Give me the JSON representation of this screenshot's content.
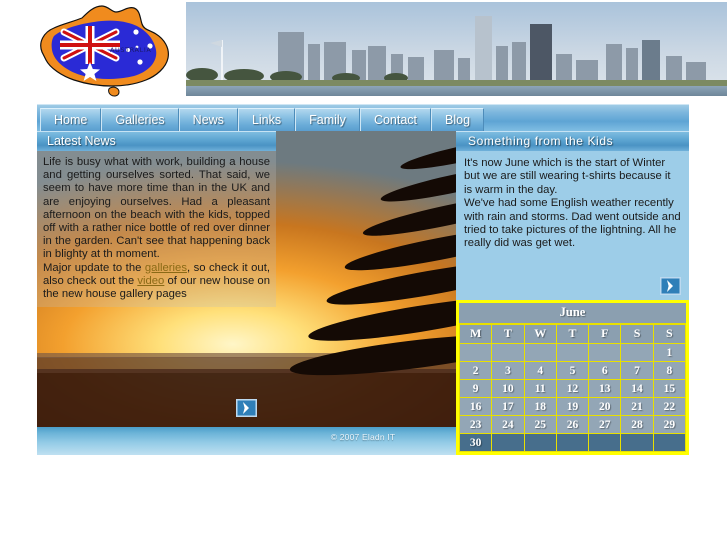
{
  "site": {
    "logo_alt": "australia-flag-map-logo",
    "logo_label": "AUSTRALIA",
    "banner_alt": "perth-city-skyline-banner"
  },
  "nav": {
    "items": [
      {
        "label": "Home"
      },
      {
        "label": "Galleries"
      },
      {
        "label": "News"
      },
      {
        "label": "Links"
      },
      {
        "label": "Family"
      },
      {
        "label": "Contact"
      },
      {
        "label": "Blog"
      }
    ]
  },
  "news_panel": {
    "title": "Latest News",
    "paragraph1": "Life is busy what with work, building a house and getting ourselves sorted.  That said, we seem to have more time than in the UK and are enjoying ourselves.   Had  a pleasant afternoon on the beach with the kids, topped off with a rather nice bottle of red over dinner in the garden.   Can't see that happening back in blighty at th moment.",
    "para2_pre": "Major  update  to  the  ",
    "link_galleries": "galleries",
    "para2_mid": ",  so  check  it out,  also  check  out  the  ",
    "link_video": "video",
    "para2_post": "  of  our  new house on the new house gallery pages",
    "more_arrow": "next-arrow-icon"
  },
  "kids_panel": {
    "title": "Something from the Kids",
    "paragraph1": "It's now June which is the start of Winter but we are still wearing t-shirts because it is warm in the day.",
    "paragraph2": "We've had some English weather recently with rain and storms.  Dad went outside and tried to take pictures of the lightning.  All he really did was get wet.",
    "more_arrow": "next-arrow-icon"
  },
  "calendar": {
    "month": "June",
    "weekday_headers": [
      "M",
      "T",
      "W",
      "T",
      "F",
      "S",
      "S"
    ],
    "weeks": [
      [
        "",
        "",
        "",
        "",
        "",
        "",
        "1"
      ],
      [
        "2",
        "3",
        "4",
        "5",
        "6",
        "7",
        "8"
      ],
      [
        "9",
        "10",
        "11",
        "12",
        "13",
        "14",
        "15"
      ],
      [
        "16",
        "17",
        "18",
        "19",
        "20",
        "21",
        "22"
      ],
      [
        "23",
        "24",
        "25",
        "26",
        "27",
        "28",
        "29"
      ],
      [
        "30",
        "",
        "",
        "",
        "",
        "",
        ""
      ]
    ],
    "border_color": "#ffff00"
  },
  "footer": {
    "copyright": "© 2007 Eladn IT"
  },
  "colors": {
    "nav_blue": "#5ea4d4",
    "panel_header_blue": "#4a93c4",
    "kids_body_blue": "#9dcde8",
    "calendar_yellow": "#ffff00",
    "link_gold": "#8a6a16"
  }
}
